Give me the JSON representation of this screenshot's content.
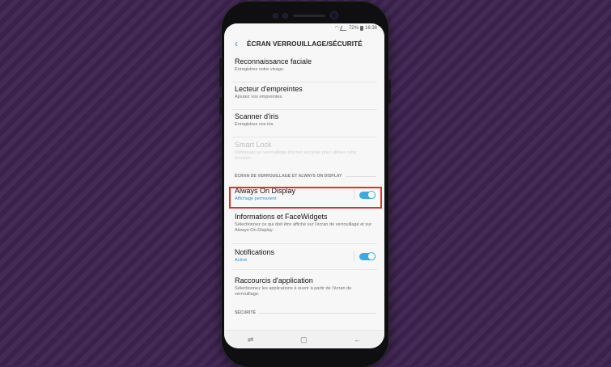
{
  "status_bar": {
    "battery": "72%",
    "time": "16:38"
  },
  "header": {
    "back_icon": "chevron-left-icon",
    "title": "ÉCRAN VERROUILLAGE/SÉCURITÉ"
  },
  "items": [
    {
      "label": "Reconnaissance faciale",
      "sub": "Enregistrez votre visage."
    },
    {
      "label": "Lecteur d'empreintes",
      "sub": "Ajoutez vos empreintes."
    },
    {
      "label": "Scanner d'iris",
      "sub": "Enregistrez vos iris."
    },
    {
      "label": "Smart Lock",
      "sub": "Définissez un verrouillage d'écran sécurisé pour utiliser cette fonction.",
      "disabled": true
    }
  ],
  "section_lock": "ÉCRAN DE VERROUILLAGE ET ALWAYS ON DISPLAY",
  "lock_items": [
    {
      "label": "Always On Display",
      "sub": "Affichage permanent",
      "toggle": true
    },
    {
      "label": "Informations et FaceWidgets",
      "sub": "Sélectionnez ce qui doit être affiché sur l'écran de verrouillage et sur Always On Display."
    },
    {
      "label": "Notifications",
      "sub": "Activé",
      "toggle": true
    },
    {
      "label": "Raccourcis d'application",
      "sub": "Sélectionnez les applications à ouvrir à partir de l'écran de verrouillage."
    }
  ],
  "section_security": "SÉCURITÉ",
  "navbar": {
    "recent": "⇌",
    "home": "▢",
    "back": "←"
  },
  "colors": {
    "accent": "#3fa9df",
    "highlight": "#d63333",
    "background": "#3d2350"
  }
}
